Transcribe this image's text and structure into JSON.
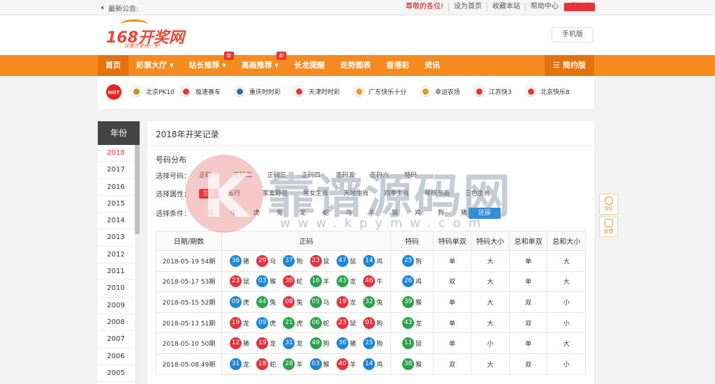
{
  "topbar": {
    "notice_label": "最新公告:",
    "links": [
      "尊敬的各位!",
      "设为首页",
      "收藏本站",
      "帮助中心",
      "手机版"
    ]
  },
  "header": {
    "logo_text": "168开奖网",
    "logo_slogan": "比官方更快一步!",
    "mobile_button": "手机版"
  },
  "nav": {
    "items": [
      {
        "label": "首页"
      },
      {
        "label": "彩票大厅 ▾"
      },
      {
        "label": "站长推荐 ▾",
        "badge": "新"
      },
      {
        "label": "高画推荐 ▾",
        "badge": "新"
      },
      {
        "label": "长龙提醒"
      },
      {
        "label": "走势图表"
      },
      {
        "label": "香港彩"
      },
      {
        "label": "资讯"
      }
    ],
    "simple_version": "☰ 简约版"
  },
  "hotbar": {
    "hot_label": "HOT",
    "items": [
      {
        "label": "北京PK10",
        "color": "#c8961e"
      },
      {
        "label": "极速赛车",
        "color": "#e33"
      },
      {
        "label": "重庆时时彩",
        "color": "#2a6fb8"
      },
      {
        "label": "天津时时彩",
        "color": "#e33"
      },
      {
        "label": "广东快乐十分",
        "color": "#f0a020"
      },
      {
        "label": "幸运农场",
        "color": "#d4a020"
      },
      {
        "label": "江苏快3",
        "color": "#e33"
      },
      {
        "label": "北京快乐8",
        "color": "#e33"
      }
    ]
  },
  "years": {
    "title": "年份",
    "list": [
      "2018",
      "2017",
      "2016",
      "2015",
      "2014",
      "2013",
      "2012",
      "2011",
      "2010",
      "2009",
      "2008",
      "2007",
      "2006",
      "2005"
    ],
    "active": "2018"
  },
  "main": {
    "title": "2018年开奖记录",
    "section_title": "号码分布",
    "filters": {
      "number_label": "选择号码：",
      "number_options": [
        "正码一",
        "正码二",
        "正码三",
        "正码四",
        "正码五",
        "正码六",
        "特码"
      ],
      "attr_label": "选择属性：",
      "attr_options": [
        "生肖",
        "五行",
        "家禽野兽",
        "男女生肖",
        "天地生肖",
        "四季生肖",
        "琴棋书画",
        "三色生肖"
      ],
      "attr_selected": "生肖",
      "cond_label": "选择条件：",
      "cond_options": [
        "鼠",
        "牛",
        "虎",
        "兔",
        "龙",
        "蛇",
        "马",
        "羊",
        "猴",
        "鸡",
        "狗",
        "猪"
      ],
      "reset": "还原"
    },
    "table": {
      "headers": [
        "日期/期数",
        "正码",
        "特码",
        "特码单双",
        "特码大小",
        "总和单双",
        "总和大小"
      ],
      "rows": [
        {
          "date": "2018-05-19 54期",
          "balls": [
            [
              "36",
              "猪",
              "blue"
            ],
            [
              "29",
              "马",
              "red"
            ],
            [
              "37",
              "狗",
              "blue"
            ],
            [
              "23",
              "鼠",
              "red"
            ],
            [
              "47",
              "鼠",
              "blue"
            ],
            [
              "14",
              "鸡",
              "blue"
            ]
          ],
          "special": [
            "25",
            "狗",
            "blue"
          ],
          "t_oe": "单",
          "t_bs": "大",
          "s_oe": "单",
          "s_bs": "大"
        },
        {
          "date": "2018-05-17 53期",
          "balls": [
            [
              "23",
              "鼠",
              "red"
            ],
            [
              "03",
              "猴",
              "blue"
            ],
            [
              "30",
              "蛇",
              "red"
            ],
            [
              "16",
              "羊",
              "green"
            ],
            [
              "43",
              "龙",
              "green"
            ],
            [
              "46",
              "牛",
              "red"
            ]
          ],
          "special": [
            "26",
            "鸡",
            "blue"
          ],
          "t_oe": "双",
          "t_bs": "大",
          "s_oe": "单",
          "s_bs": "大"
        },
        {
          "date": "2018-05-15 52期",
          "balls": [
            [
              "09",
              "虎",
              "blue"
            ],
            [
              "44",
              "兔",
              "green"
            ],
            [
              "08",
              "兔",
              "red"
            ],
            [
              "05",
              "马",
              "green"
            ],
            [
              "19",
              "龙",
              "red"
            ],
            [
              "32",
              "兔",
              "green"
            ]
          ],
          "special": [
            "39",
            "猴",
            "green"
          ],
          "t_oe": "单",
          "t_bs": "大",
          "s_oe": "双",
          "s_bs": "小"
        },
        {
          "date": "2018-05-13 51期",
          "balls": [
            [
              "19",
              "龙",
              "red"
            ],
            [
              "09",
              "虎",
              "blue"
            ],
            [
              "21",
              "虎",
              "green"
            ],
            [
              "06",
              "蛇",
              "green"
            ],
            [
              "23",
              "鼠",
              "red"
            ],
            [
              "01",
              "狗",
              "red"
            ]
          ],
          "special": [
            "43",
            "龙",
            "green"
          ],
          "t_oe": "单",
          "t_bs": "大",
          "s_oe": "双",
          "s_bs": "小"
        },
        {
          "date": "2018-05-10 50期",
          "balls": [
            [
              "12",
              "猪",
              "red"
            ],
            [
              "19",
              "龙",
              "red"
            ],
            [
              "31",
              "龙",
              "blue"
            ],
            [
              "49",
              "狗",
              "green"
            ],
            [
              "36",
              "猪",
              "blue"
            ],
            [
              "25",
              "狗",
              "blue"
            ]
          ],
          "special": [
            "11",
            "鼠",
            "green"
          ],
          "t_oe": "单",
          "t_bs": "小",
          "s_oe": "单",
          "s_bs": "大"
        },
        {
          "date": "2018-05-08 49期",
          "balls": [
            [
              "31",
              "龙",
              "blue"
            ],
            [
              "18",
              "蛇",
              "red"
            ],
            [
              "28",
              "羊",
              "green"
            ],
            [
              "03",
              "猴",
              "blue"
            ],
            [
              "40",
              "羊",
              "red"
            ],
            [
              "14",
              "鸡",
              "blue"
            ]
          ],
          "special": [
            "38",
            "猴",
            "green"
          ],
          "t_oe": "双",
          "t_bs": "大",
          "s_oe": "双",
          "s_bs": "小"
        }
      ]
    }
  },
  "watermark": {
    "letter": "K",
    "text": "靠谱源码网",
    "url": "www.kpymw.com"
  },
  "side_float": {
    "qq": "QQ",
    "feedback": "反馈"
  }
}
